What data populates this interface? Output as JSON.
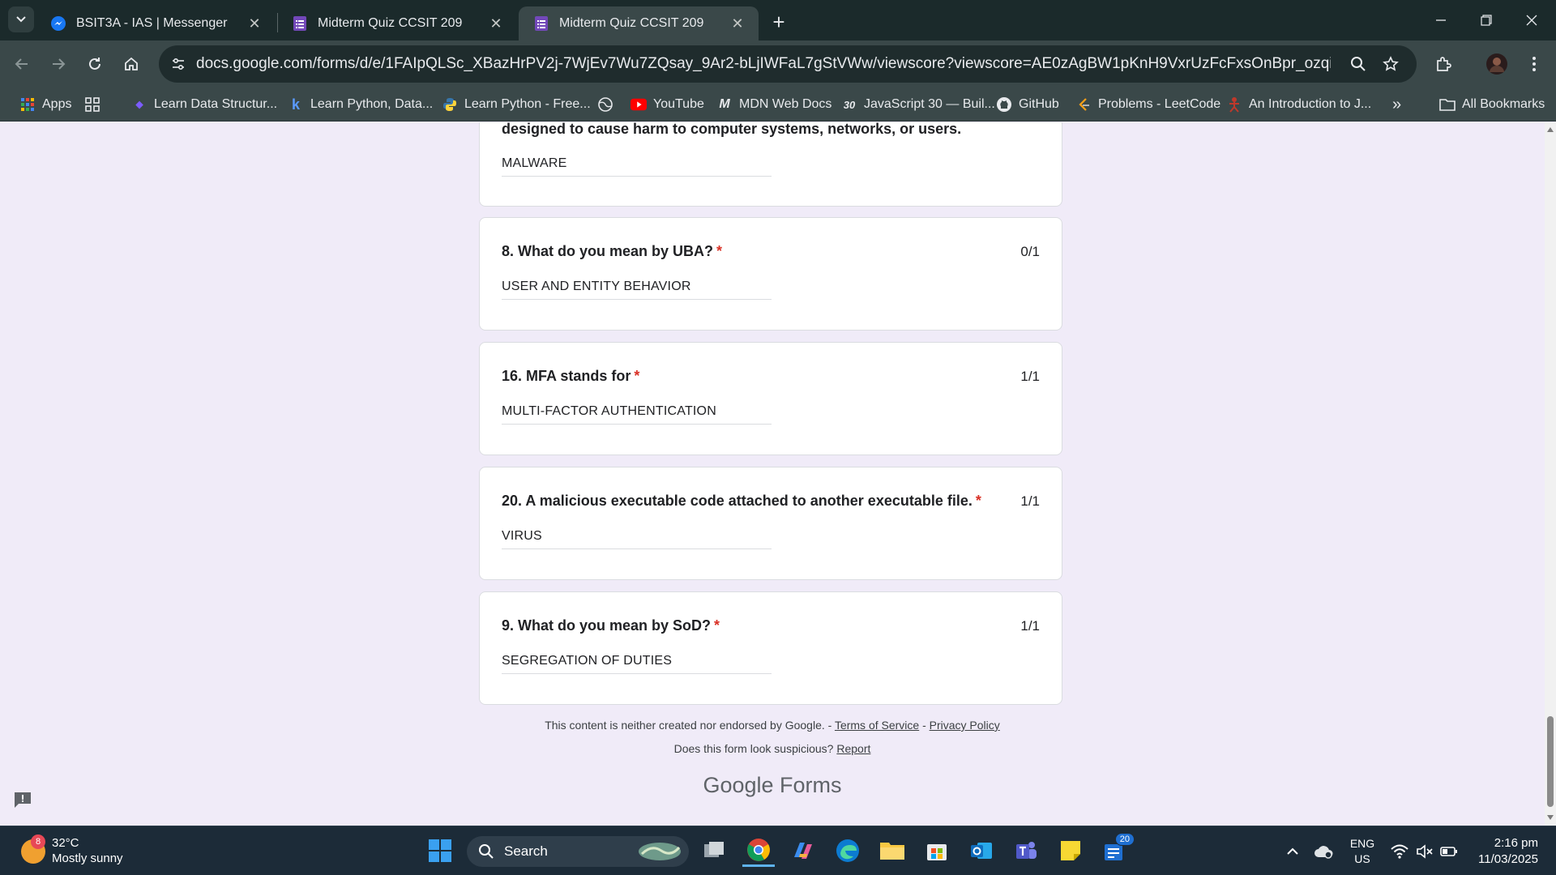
{
  "browser": {
    "tabs": [
      {
        "title": "BSIT3A - IAS | Messenger",
        "icon": "messenger-icon",
        "active": false
      },
      {
        "title": "Midterm Quiz CCSIT 209",
        "icon": "google-forms-icon",
        "active": false
      },
      {
        "title": "Midterm Quiz CCSIT 209",
        "icon": "google-forms-icon",
        "active": true
      }
    ],
    "url": "docs.google.com/forms/d/e/1FAIpQLSc_XBazHrPV2j-7WjEv7Wu7ZQsay_9Ar2-bLjIWFaL7gStVWw/viewscore?viewscore=AE0zAgBW1pKnH9VxrUzFcFxsOnBpr_ozqi1-02bHNzJpDwO-Z...",
    "bookmarks": [
      {
        "label": "Apps",
        "icon": "apps-grid-icon"
      },
      {
        "label": "Learn Data Structur...",
        "icon": "bookmark-icon"
      },
      {
        "label": "Learn Python, Data...",
        "icon": "k-logo-icon"
      },
      {
        "label": "Learn Python - Free...",
        "icon": "python-icon"
      },
      {
        "label": "YouTube",
        "icon": "youtube-icon"
      },
      {
        "label": "MDN Web Docs",
        "icon": "mdn-icon"
      },
      {
        "label": "JavaScript 30 — Buil...",
        "icon": "js30-icon"
      },
      {
        "label": "GitHub",
        "icon": "github-icon"
      },
      {
        "label": "Problems - LeetCode",
        "icon": "leetcode-icon"
      },
      {
        "label": "An Introduction to J...",
        "icon": "intro-icon"
      }
    ],
    "all_bookmarks": "All Bookmarks",
    "overflow": "»"
  },
  "form": {
    "partial_question": {
      "text": "designed to cause harm to computer systems, networks, or users.",
      "answer": "MALWARE"
    },
    "questions": [
      {
        "title": "8.  What do you mean by UBA?",
        "score": "0/1",
        "answer": "USER AND ENTITY BEHAVIOR"
      },
      {
        "title": "16. MFA stands for",
        "score": "1/1",
        "answer": "MULTI-FACTOR AUTHENTICATION"
      },
      {
        "title": "20. A malicious executable code attached to another executable file.",
        "score": "1/1",
        "answer": "VIRUS"
      },
      {
        "title": "9.  What do you mean by SoD?",
        "score": "1/1",
        "answer": "SEGREGATION OF DUTIES"
      }
    ],
    "required_mark": "*",
    "footer": {
      "disclaimer": "This content is neither created nor endorsed by Google. -",
      "terms": "Terms of Service",
      "dash": "-",
      "privacy": "Privacy Policy",
      "suspicious": "Does this form look suspicious?",
      "report": "Report",
      "logo_google": "Google",
      "logo_forms": "Forms"
    }
  },
  "taskbar": {
    "weather": {
      "temp": "32°C",
      "condition": "Mostly sunny",
      "badge": "8"
    },
    "search_label": "Search",
    "tray_lang_1": "ENG",
    "tray_lang_2": "US",
    "time": "2:16 pm",
    "date": "11/03/2025",
    "widgets_badge": "20"
  }
}
